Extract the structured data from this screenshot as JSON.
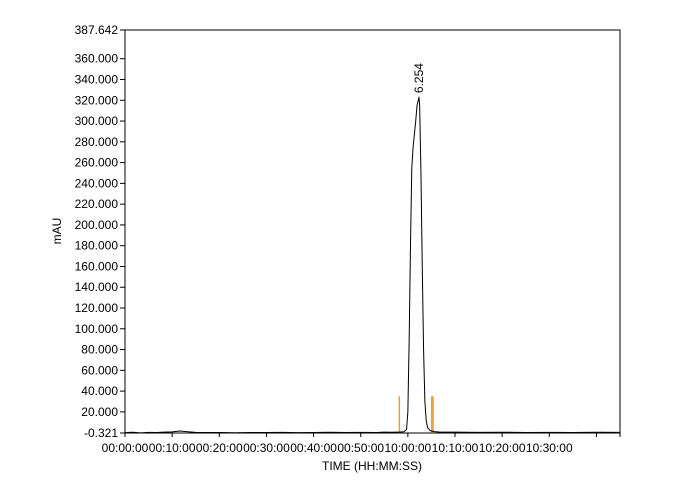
{
  "chart_data": {
    "type": "line",
    "title": "",
    "xlabel": "TIME (HH:MM:SS)",
    "ylabel": "mAU",
    "x_unit": "seconds",
    "xlim": [
      0,
      37800
    ],
    "ylim": [
      -0.321,
      387.642
    ],
    "x_ticks": [
      0,
      3600,
      7200,
      10800,
      14400,
      18000,
      21600,
      25200,
      28800,
      32400,
      36000,
      37800
    ],
    "x_tick_labels": [
      "00:00:00",
      "00:10:00",
      "00:20:00",
      "00:30:00",
      "00:40:00",
      "00:50:00",
      "10:00:00",
      "10:10:00",
      "10:20:00",
      "10:30:00"
    ],
    "y_ticks": [
      -0.321,
      20,
      40,
      60,
      80,
      100,
      120,
      140,
      160,
      180,
      200,
      220,
      240,
      260,
      280,
      300,
      320,
      340,
      360,
      387.642
    ],
    "y_tick_labels": [
      "-0.321",
      "20.000",
      "40.000",
      "60.000",
      "80.000",
      "100.000",
      "120.000",
      "140.000",
      "160.000",
      "180.000",
      "200.000",
      "220.000",
      "240.000",
      "260.000",
      "280.000",
      "300.000",
      "320.000",
      "340.000",
      "360.000",
      "387.642"
    ],
    "series": [
      {
        "color": "#000000",
        "points": [
          [
            0,
            0.0
          ],
          [
            600,
            0.4
          ],
          [
            1200,
            -0.2
          ],
          [
            1800,
            0.3
          ],
          [
            2400,
            0.1
          ],
          [
            3000,
            0.5
          ],
          [
            3600,
            0.8
          ],
          [
            4200,
            1.6
          ],
          [
            4800,
            0.9
          ],
          [
            5400,
            0.3
          ],
          [
            6000,
            0.1
          ],
          [
            7200,
            0.2
          ],
          [
            8400,
            -0.1
          ],
          [
            9600,
            0.2
          ],
          [
            10800,
            0.1
          ],
          [
            12000,
            0.3
          ],
          [
            13200,
            0.0
          ],
          [
            14400,
            0.2
          ],
          [
            15600,
            0.4
          ],
          [
            16800,
            0.1
          ],
          [
            18000,
            0.3
          ],
          [
            19200,
            0.2
          ],
          [
            19800,
            0.5
          ],
          [
            20400,
            0.4
          ],
          [
            21000,
            0.6
          ],
          [
            21300,
            0.9
          ],
          [
            21500,
            3.0
          ],
          [
            21600,
            20.0
          ],
          [
            21700,
            90.0
          ],
          [
            21800,
            180.0
          ],
          [
            21900,
            255.0
          ],
          [
            22000,
            275.0
          ],
          [
            22200,
            300.0
          ],
          [
            22300,
            315.0
          ],
          [
            22450,
            323.0
          ],
          [
            22500,
            315.0
          ],
          [
            22600,
            250.0
          ],
          [
            22700,
            160.0
          ],
          [
            22800,
            80.0
          ],
          [
            22900,
            30.0
          ],
          [
            23000,
            12.0
          ],
          [
            23100,
            5.0
          ],
          [
            23300,
            2.0
          ],
          [
            23600,
            1.0
          ],
          [
            24000,
            0.6
          ],
          [
            25200,
            0.5
          ],
          [
            27000,
            0.3
          ],
          [
            28800,
            0.4
          ],
          [
            30600,
            0.2
          ],
          [
            32400,
            0.3
          ],
          [
            34200,
            0.2
          ],
          [
            36000,
            0.4
          ],
          [
            37800,
            0.3
          ]
        ]
      }
    ],
    "peaks": [
      {
        "label": "6.254",
        "x": 22450,
        "y": 323.0
      }
    ],
    "integration_markers": {
      "color": "#e8a13a",
      "x": [
        20950,
        23420,
        23520
      ],
      "height": [
        35,
        35,
        35
      ]
    },
    "grid": false,
    "legend": "none"
  }
}
